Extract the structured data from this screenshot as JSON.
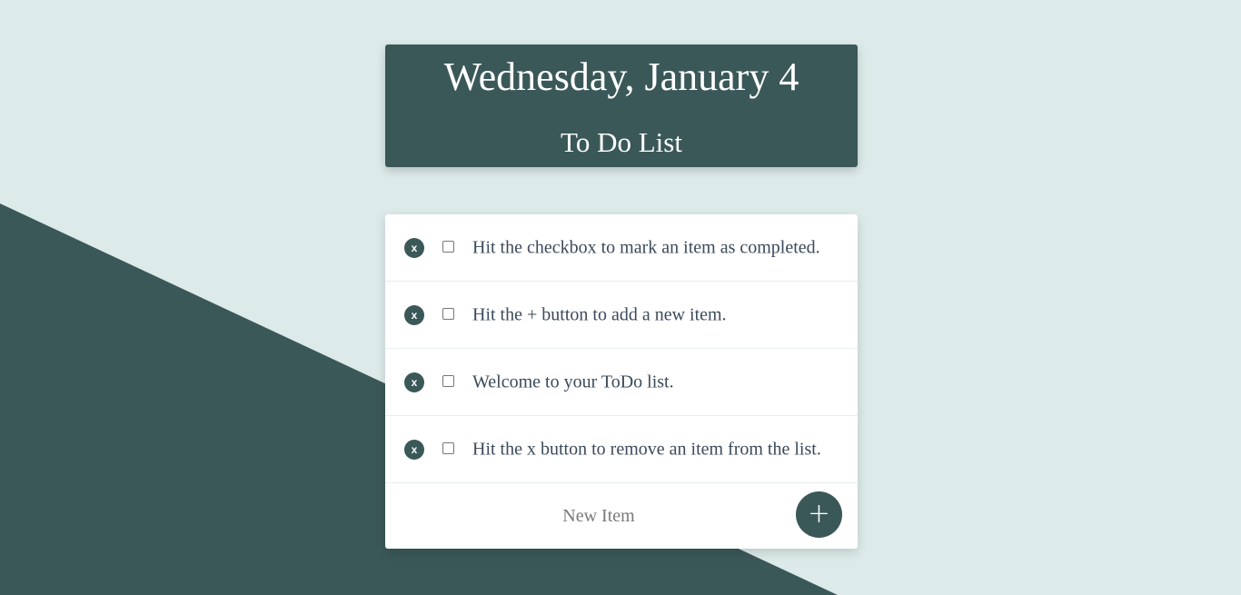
{
  "header": {
    "date": "Wednesday, January 4",
    "title": "To Do List"
  },
  "todo_items": [
    {
      "remove_label": "x",
      "text": "Hit the checkbox to mark an item as completed.",
      "completed": false
    },
    {
      "remove_label": "x",
      "text": "Hit the + button to add a new item.",
      "completed": false
    },
    {
      "remove_label": "x",
      "text": "Welcome to your ToDo list.",
      "completed": false
    },
    {
      "remove_label": "x",
      "text": "Hit the x button to remove an item from the list.",
      "completed": false
    }
  ],
  "new_item": {
    "placeholder": "New Item",
    "value": "",
    "add_label": "+"
  },
  "colors": {
    "background": "#dceae9",
    "accent": "#3b5858",
    "card": "#ffffff",
    "text": "#3b4a5a"
  }
}
